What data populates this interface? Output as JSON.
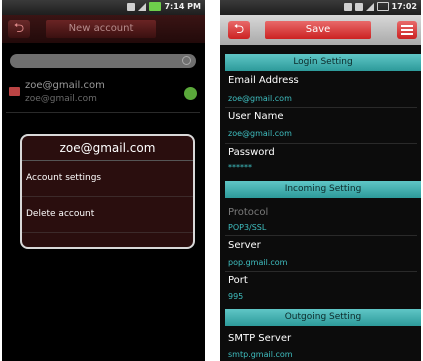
{
  "left": {
    "status": {
      "time": "7:14 PM"
    },
    "topbar": {
      "new_account_label": "New account",
      "back_glyph": "⮌"
    },
    "account": {
      "email": "zoe@gmail.com",
      "subtitle": "zoe@gmail.com"
    },
    "dialog": {
      "title": "zoe@gmail.com",
      "items": [
        "Account settings",
        "Delete account"
      ]
    },
    "icons": [
      "back-icon",
      "search-icon",
      "mail-icon",
      "check-icon",
      "signal-icon",
      "battery-icon"
    ]
  },
  "right": {
    "status": {
      "time": "17:02"
    },
    "topbar": {
      "save_label": "Save",
      "back_glyph": "⮌"
    },
    "login": {
      "header": "Login Setting",
      "email_label": "Email Address",
      "email_value": "zoe@gmail.com",
      "user_label": "User Name",
      "user_value": "zoe@gmail.com",
      "password_label": "Password",
      "password_value": "******"
    },
    "incoming": {
      "header": "Incoming Setting",
      "protocol_label": "Protocol",
      "protocol_value": "POP3/SSL",
      "server_label": "Server",
      "server_value": "pop.gmail.com",
      "port_label": "Port",
      "port_value": "995"
    },
    "outgoing": {
      "header": "Outgoing Setting",
      "smtp_label": "SMTP Server",
      "smtp_value": "smtp.gmail.com"
    },
    "icons": [
      "back-icon",
      "menu-icon",
      "signal-icon",
      "battery-icon"
    ]
  },
  "colors": {
    "accent_red": "#d12f2f",
    "section_teal": "#3aa9a9",
    "value_teal": "#3fbfc1"
  }
}
